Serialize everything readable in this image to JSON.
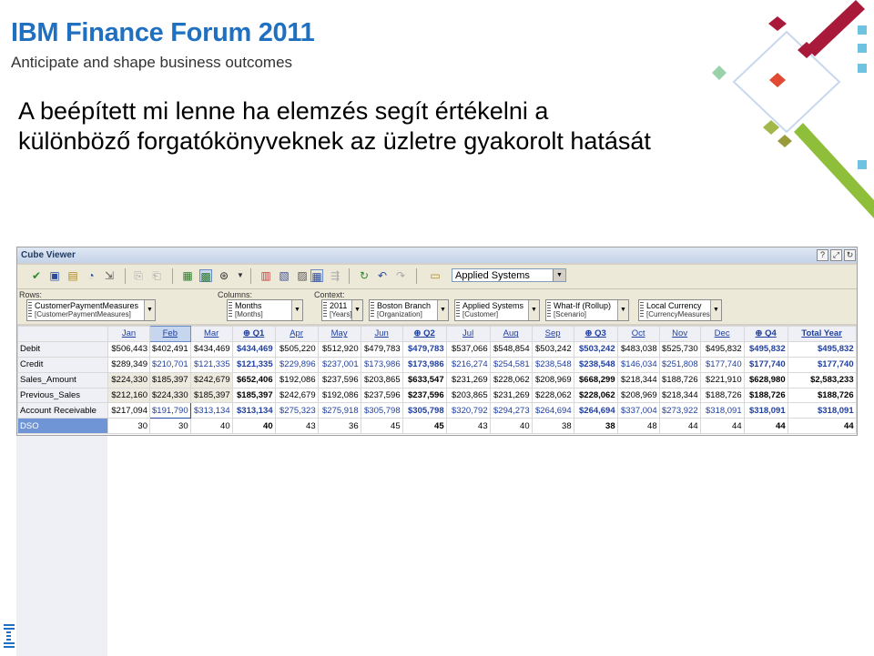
{
  "slide": {
    "brand_title": "IBM Finance Forum 2011",
    "brand_subtitle": "Anticipate and shape business outcomes",
    "title_line1": "A beépített mi lenne ha elemzés segít értékelni a",
    "title_line2": "különböző forgatókönyveknek az üzletre gyakorolt hatását"
  },
  "cube_viewer": {
    "title": "Cube Viewer",
    "title_buttons": [
      "?",
      "⤢",
      "↻"
    ],
    "view_select": "Applied Systems",
    "rows_label": "Rows:",
    "columns_label": "Columns:",
    "context_label": "Context:",
    "rows_chip": {
      "name": "CustomerPaymentMeasures",
      "sub": "[CustomerPaymentMeasures]"
    },
    "columns_chip": {
      "name": "Months",
      "sub": "[Months]"
    },
    "context_chips": [
      {
        "name": "2011",
        "sub": "[Years]"
      },
      {
        "name": "Boston Branch",
        "sub": "[Organization]"
      },
      {
        "name": "Applied Systems",
        "sub": "[Customer]"
      },
      {
        "name": "What-If (Rollup)",
        "sub": "[Scenario]"
      },
      {
        "name": "Local Currency",
        "sub": "[CurrencyMeasures]"
      }
    ],
    "columns": [
      "Jan",
      "Feb",
      "Mar",
      "⊕ Q1",
      "Apr",
      "May",
      "Jun",
      "⊕ Q2",
      "Jul",
      "Aug",
      "Sep",
      "⊕ Q3",
      "Oct",
      "Nov",
      "Dec",
      "⊕ Q4",
      "Total Year"
    ],
    "rows": [
      {
        "label": "Debit",
        "values": [
          "$506,443",
          "$402,491",
          "$434,469",
          "$434,469",
          "$505,220",
          "$512,920",
          "$479,783",
          "$479,783",
          "$537,066",
          "$548,854",
          "$503,242",
          "$503,242",
          "$483,038",
          "$525,730",
          "$495,832",
          "$495,832",
          "$495,832"
        ]
      },
      {
        "label": "Credit",
        "values": [
          "$289,349",
          "$210,701",
          "$121,335",
          "$121,335",
          "$229,896",
          "$237,001",
          "$173,986",
          "$173,986",
          "$216,274",
          "$254,581",
          "$238,548",
          "$238,548",
          "$146,034",
          "$251,808",
          "$177,740",
          "$177,740",
          "$177,740"
        ]
      },
      {
        "label": "Sales_Amount",
        "values": [
          "$224,330",
          "$185,397",
          "$242,679",
          "$652,406",
          "$192,086",
          "$237,596",
          "$203,865",
          "$633,547",
          "$231,269",
          "$228,062",
          "$208,969",
          "$668,299",
          "$218,344",
          "$188,726",
          "$221,910",
          "$628,980",
          "$2,583,233"
        ]
      },
      {
        "label": "Previous_Sales",
        "values": [
          "$212,160",
          "$224,330",
          "$185,397",
          "$185,397",
          "$242,679",
          "$192,086",
          "$237,596",
          "$237,596",
          "$203,865",
          "$231,269",
          "$228,062",
          "$228,062",
          "$208,969",
          "$218,344",
          "$188,726",
          "$188,726",
          "$188,726"
        ]
      },
      {
        "label": "Account Receivable",
        "values": [
          "$217,094",
          "$191,790",
          "$313,134",
          "$313,134",
          "$275,323",
          "$275,918",
          "$305,798",
          "$305,798",
          "$320,792",
          "$294,273",
          "$264,694",
          "$264,694",
          "$337,004",
          "$273,922",
          "$318,091",
          "$318,091",
          "$318,091"
        ]
      },
      {
        "label": "DSO",
        "values": [
          "30",
          "30",
          "40",
          "40",
          "43",
          "36",
          "45",
          "45",
          "43",
          "40",
          "38",
          "38",
          "48",
          "44",
          "44",
          "44",
          "44"
        ]
      }
    ]
  }
}
